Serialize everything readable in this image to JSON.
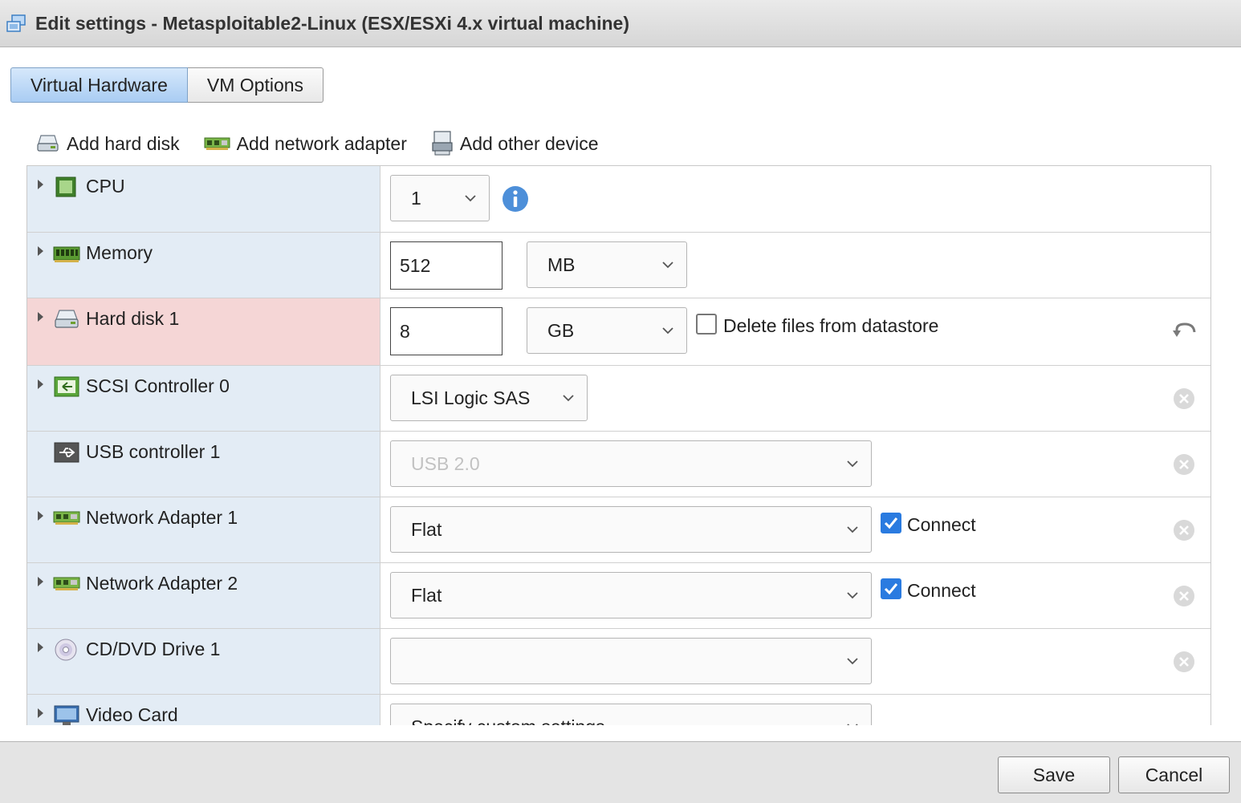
{
  "window": {
    "title": "Edit settings - Metasploitable2-Linux (ESX/ESXi 4.x virtual machine)",
    "icon": "vm-settings-icon"
  },
  "tabs": [
    {
      "label": "Virtual Hardware",
      "active": true
    },
    {
      "label": "VM Options",
      "active": false
    }
  ],
  "toolbar": {
    "add_hard_disk": "Add hard disk",
    "add_network_adapter": "Add network adapter",
    "add_other_device": "Add other device"
  },
  "devices": {
    "cpu": {
      "label": "CPU",
      "icon": "cpu-icon",
      "value": "1"
    },
    "memory": {
      "label": "Memory",
      "icon": "memory-icon",
      "value": "512",
      "unit": "MB"
    },
    "hard_disk_1": {
      "label": "Hard disk 1",
      "icon": "hard-disk-icon",
      "value": "8",
      "unit": "GB",
      "delete_label": "Delete files from datastore",
      "delete_checked": false,
      "highlight_color": "#f5d6d6"
    },
    "scsi_controller_0": {
      "label": "SCSI Controller 0",
      "icon": "scsi-icon",
      "value": "LSI Logic SAS"
    },
    "usb_controller_1": {
      "label": "USB controller 1",
      "icon": "usb-icon",
      "value": "USB 2.0",
      "disabled": true
    },
    "network_adapter_1": {
      "label": "Network Adapter 1",
      "icon": "network-card-icon",
      "value": "Flat",
      "connect_label": "Connect",
      "connect_checked": true
    },
    "network_adapter_2": {
      "label": "Network Adapter 2",
      "icon": "network-card-icon",
      "value": "Flat",
      "connect_label": "Connect",
      "connect_checked": true
    },
    "cd_dvd_drive_1": {
      "label": "CD/DVD Drive 1",
      "icon": "cd-dvd-icon",
      "value": ""
    },
    "video_card": {
      "label": "Video Card",
      "icon": "monitor-icon",
      "value": "Specify custom settings"
    }
  },
  "footer": {
    "save_label": "Save",
    "cancel_label": "Cancel"
  },
  "colors": {
    "accent": "#2a7be0",
    "row_label_bg": "#e3ecf5",
    "tab_active_bg": "#a9ccf3"
  }
}
